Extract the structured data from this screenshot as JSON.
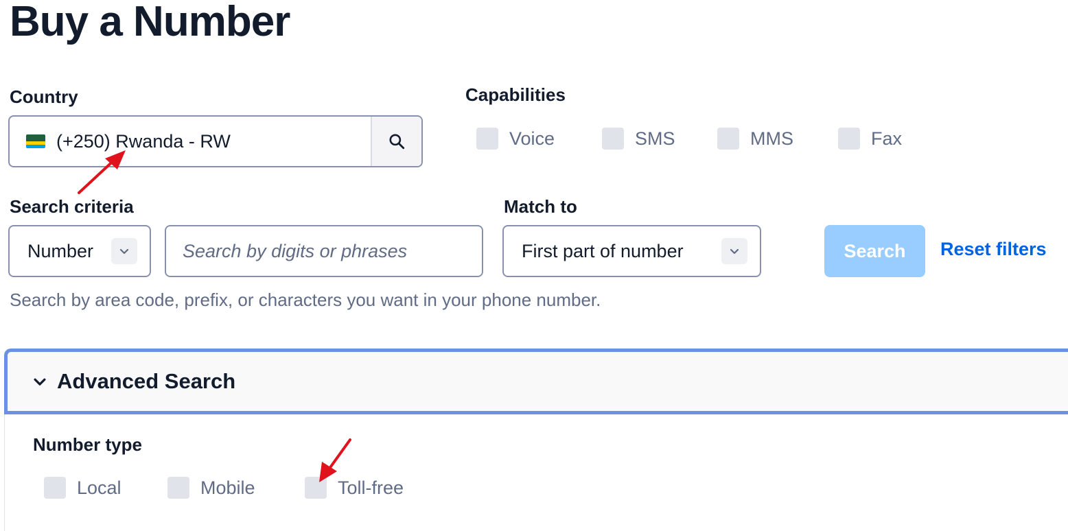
{
  "page": {
    "title": "Buy a Number"
  },
  "country": {
    "label": "Country",
    "flag_icon": "rwanda-flag-icon",
    "value": "(+250) Rwanda - RW",
    "search_icon": "search-icon"
  },
  "capabilities": {
    "label": "Capabilities",
    "options": [
      {
        "label": "Voice",
        "checked": false
      },
      {
        "label": "SMS",
        "checked": false
      },
      {
        "label": "MMS",
        "checked": false
      },
      {
        "label": "Fax",
        "checked": false
      }
    ]
  },
  "search_criteria": {
    "label": "Search criteria",
    "selected": "Number",
    "input_placeholder": "Search by digits or phrases",
    "input_value": "",
    "helper_text": "Search by area code, prefix, or characters you want in your phone number."
  },
  "match_to": {
    "label": "Match to",
    "selected": "First part of number"
  },
  "actions": {
    "search_label": "Search",
    "reset_label": "Reset filters"
  },
  "advanced_search": {
    "title": "Advanced Search",
    "expanded": true,
    "number_type": {
      "label": "Number type",
      "options": [
        {
          "label": "Local",
          "checked": false
        },
        {
          "label": "Mobile",
          "checked": false
        },
        {
          "label": "Toll-free",
          "checked": false
        }
      ]
    }
  },
  "colors": {
    "accent": "#0263e0",
    "search_button_disabled": "#99cdff",
    "annotation_arrow": "#e0121c",
    "advanced_border": "#6a91e3"
  }
}
